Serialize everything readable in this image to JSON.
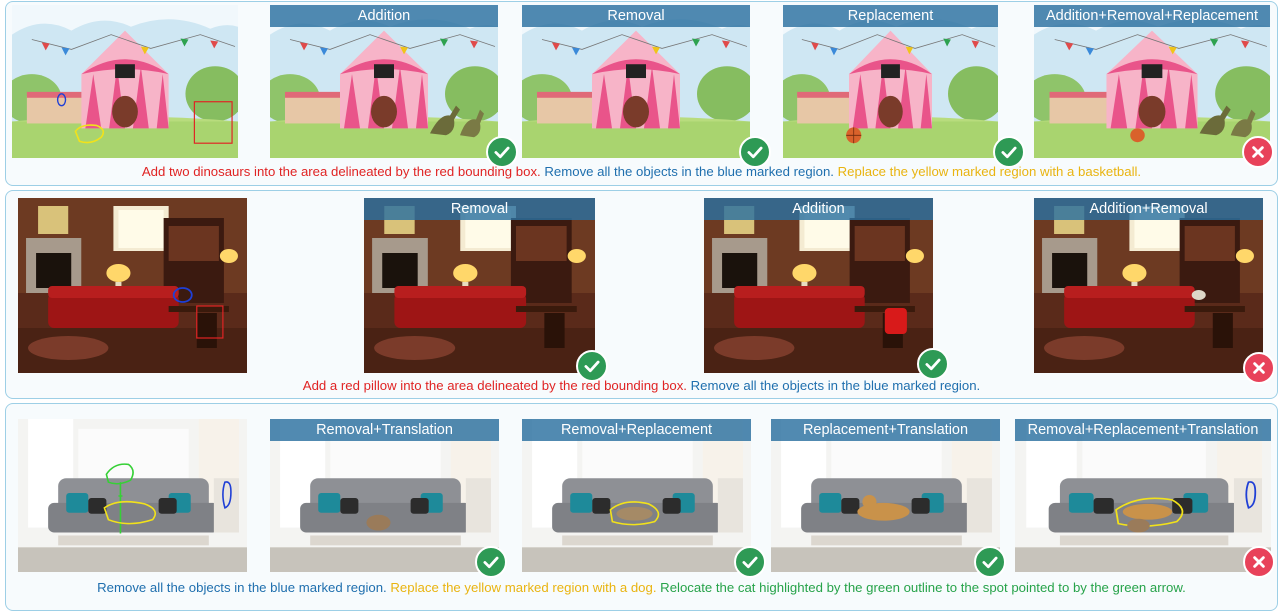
{
  "colors": {
    "header_bg": "#2b70a0",
    "panel_border": "#9dcfe6",
    "success": "#2e9a55",
    "failure": "#e8425a",
    "red_text": "#e02424",
    "blue_text": "#1f6fae",
    "yellow_text": "#e9b411",
    "green_text": "#27a34a"
  },
  "rows": [
    {
      "headers": [
        "Addition",
        "Removal",
        "Replacement",
        "Addition+Removal+Replacement"
      ],
      "results": [
        "success",
        "success",
        "success",
        "failure"
      ],
      "captions": [
        {
          "text": "Add two dinosaurs into the area delineated by the red bounding box.",
          "color": "red"
        },
        {
          "text": "Remove all the objects in the blue marked region.",
          "color": "blue"
        },
        {
          "text": "Replace the yellow marked region with a basketball.",
          "color": "yellow"
        }
      ]
    },
    {
      "headers": [
        "Removal",
        "Addition",
        "Addition+Removal"
      ],
      "results": [
        "success",
        "success",
        "failure"
      ],
      "captions": [
        {
          "text": "Add a red pillow into the area delineated by the red bounding box.",
          "color": "red"
        },
        {
          "text": "Remove all the objects in the blue marked region.",
          "color": "blue"
        }
      ]
    },
    {
      "headers": [
        "Removal+Translation",
        "Removal+Replacement",
        "Replacement+Translation",
        "Removal+Replacement+Translation"
      ],
      "results": [
        "success",
        "success",
        "success",
        "failure"
      ],
      "captions": [
        {
          "text": "Remove all the objects in the blue marked region.",
          "color": "blue"
        },
        {
          "text": "Replace the yellow marked region with a dog.",
          "color": "yellow"
        },
        {
          "text": "Relocate the cat highlighted by the green outline to the spot pointed to by the green arrow.",
          "color": "green"
        }
      ]
    }
  ]
}
